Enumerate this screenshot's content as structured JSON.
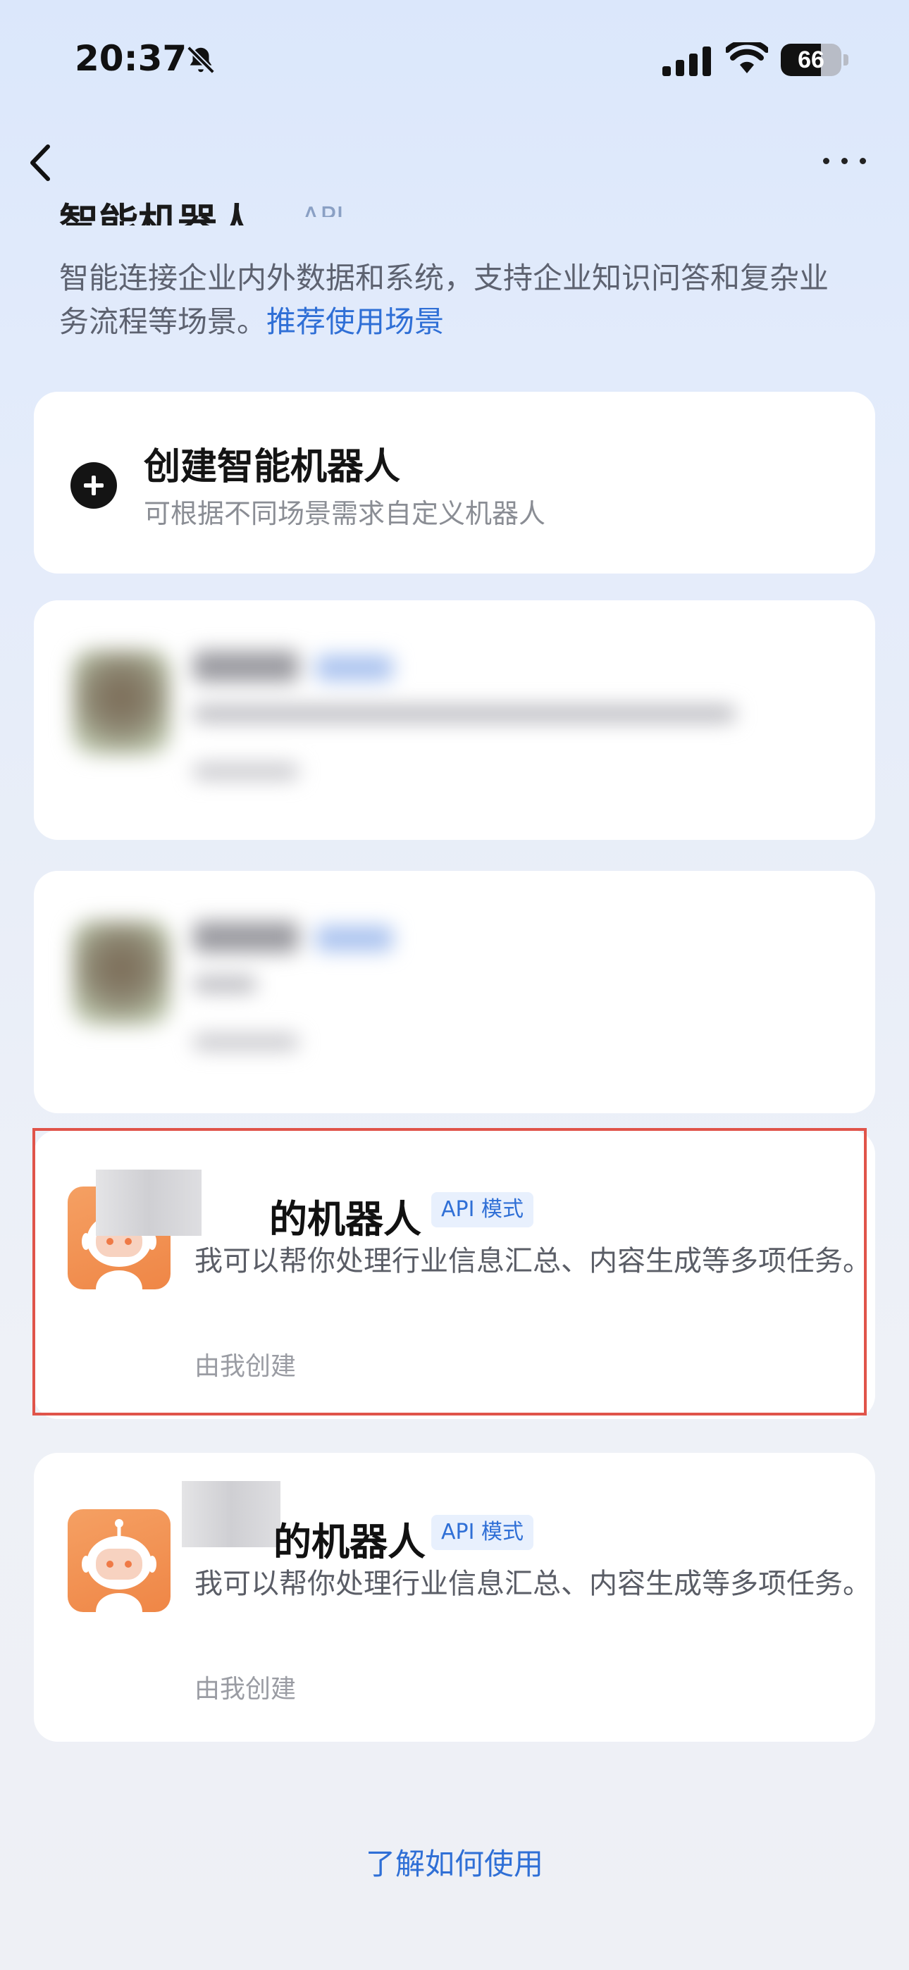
{
  "status_bar": {
    "time": "20:37",
    "battery": "66",
    "battery_level": 0.66,
    "icons": [
      "bell-slash-icon",
      "signal-icon",
      "wifi-icon",
      "battery-icon"
    ]
  },
  "nav": {
    "back_icon": "chevron-left-icon",
    "more_icon": "more-horizontal-icon"
  },
  "section": {
    "title": "智能机器人",
    "badge": "API",
    "intro": "智能连接企业内外数据和系统，支持企业知识问答和复杂业务流程等场景。",
    "intro_link": "推荐使用场景"
  },
  "create_card": {
    "icon": "plus-circle-icon",
    "title": "创建智能机器人",
    "subtitle": "可根据不同场景需求自定义机器人"
  },
  "bots": [
    {
      "name": "的机器人",
      "tag": "API 模式",
      "description": "我可以帮你处理行业信息汇总、内容生成等多项任务。",
      "meta": "由我创建",
      "avatar_icon": "robot-icon"
    },
    {
      "name": "的机器人",
      "tag": "API 模式",
      "description": "我可以帮你处理行业信息汇总、内容生成等多项任务。",
      "meta": "由我创建",
      "avatar_icon": "robot-icon"
    }
  ],
  "footer": {
    "link": "了解如何使用"
  },
  "colors": {
    "accent": "#2f6fd6",
    "highlight_border": "#e0544a",
    "avatar_orange": "#ef8646"
  }
}
